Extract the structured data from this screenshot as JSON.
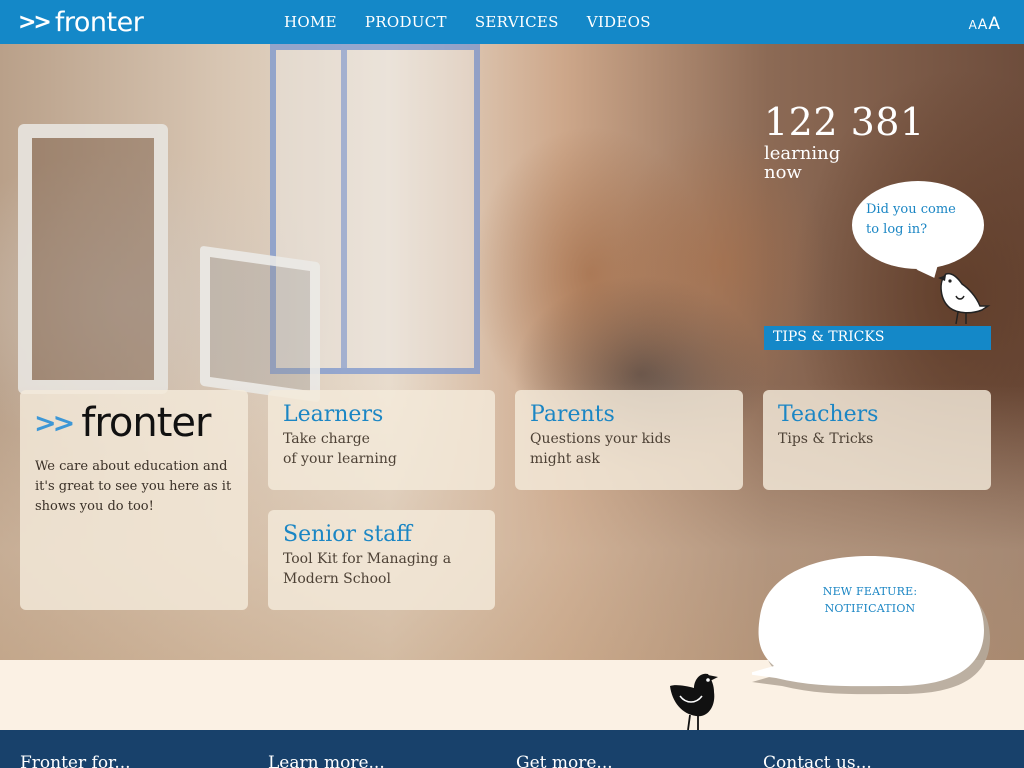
{
  "header": {
    "logo_chevrons": ">>",
    "logo_text": "fronter",
    "nav": [
      {
        "label": "HOME"
      },
      {
        "label": "PRODUCT"
      },
      {
        "label": "SERVICES"
      },
      {
        "label": "VIDEOS"
      }
    ],
    "text_size": [
      "A",
      "A",
      "A"
    ]
  },
  "hero": {
    "counter": "122 381",
    "counter_label_line1": "learning",
    "counter_label_line2": "now",
    "login_bubble_line1": "Did you come",
    "login_bubble_line2": "to log in?",
    "tips_bar": "TIPS & TRICKS"
  },
  "brand_card": {
    "logo_chevrons": ">>",
    "logo_text": "fronter",
    "about": "We care about education and it's great to see you here as it shows you do too!"
  },
  "cards": {
    "learners": {
      "title": "Learners",
      "line1": "Take charge",
      "line2": "of your learning"
    },
    "parents": {
      "title": "Parents",
      "line1": "Questions your kids",
      "line2": "might ask"
    },
    "teachers": {
      "title": "Teachers",
      "line1": "Tips & Tricks",
      "line2": ""
    },
    "senior": {
      "title": "Senior staff",
      "line1": "Tool Kit for Managing a",
      "line2": "Modern School"
    }
  },
  "feature": {
    "line1": "NEW FEATURE:",
    "line2": "NOTIFICATION"
  },
  "footer": {
    "cols": [
      "Fronter for...",
      "Learn more...",
      "Get more...",
      "Contact us..."
    ]
  },
  "colors": {
    "brand_blue": "#1488c8",
    "footer_navy": "#18416b",
    "card_text_blue": "#1b86c4"
  }
}
